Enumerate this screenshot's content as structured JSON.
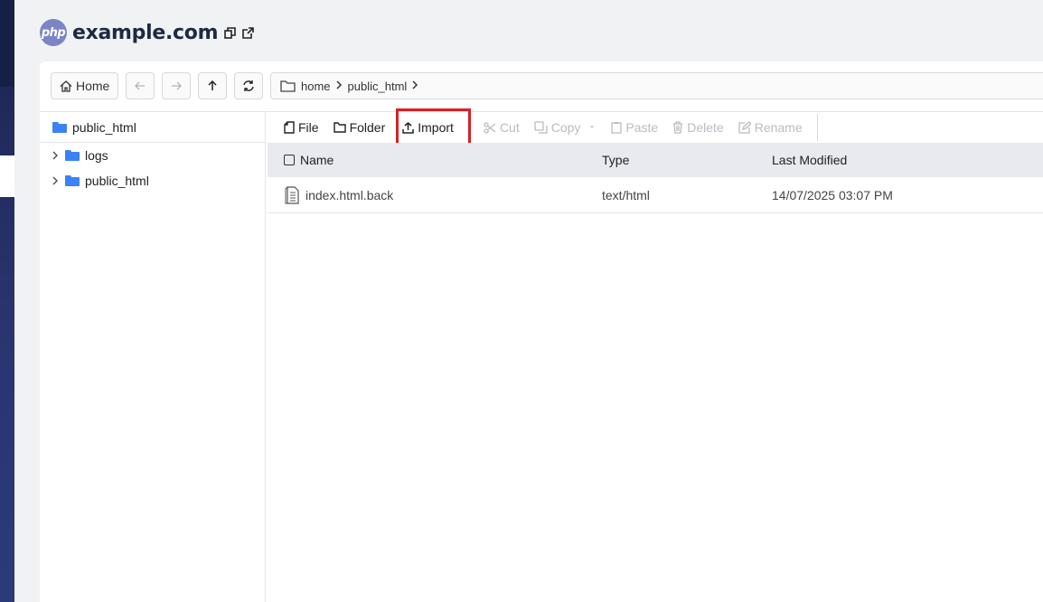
{
  "site": {
    "title": "example.com",
    "logo_text": "php"
  },
  "nav": {
    "home_label": "Home",
    "breadcrumb": [
      "home",
      "public_html"
    ]
  },
  "tree": {
    "root": "public_html",
    "items": [
      {
        "label": "logs"
      },
      {
        "label": "public_html"
      }
    ]
  },
  "toolbar": {
    "file_label": "File",
    "folder_label": "Folder",
    "import_label": "Import",
    "cut_label": "Cut",
    "copy_label": "Copy",
    "paste_label": "Paste",
    "delete_label": "Delete",
    "rename_label": "Rename",
    "highlight_color": "#d91f26"
  },
  "table": {
    "columns": [
      "Name",
      "Type",
      "Last Modified"
    ],
    "rows": [
      {
        "name": "index.html.back",
        "type": "text/html",
        "modified": "14/07/2025 03:07 PM"
      }
    ]
  },
  "colors": {
    "accent_folder": "#3b82f6",
    "rail": "#2a3570"
  }
}
